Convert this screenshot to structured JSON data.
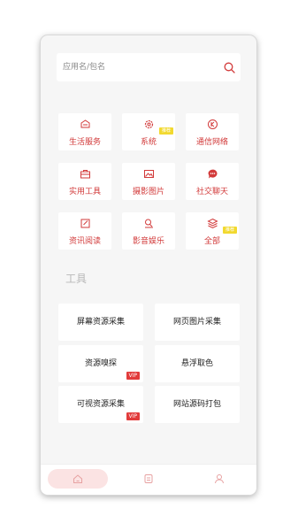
{
  "search": {
    "placeholder": "应用名/包名",
    "icon": "search-icon"
  },
  "categories": [
    {
      "label": "生活服务",
      "icon": "life-service-icon"
    },
    {
      "label": "系统",
      "icon": "system-gear-icon",
      "tag": "推荐"
    },
    {
      "label": "通信网络",
      "icon": "network-icon"
    },
    {
      "label": "实用工具",
      "icon": "toolbox-icon"
    },
    {
      "label": "摄影图片",
      "icon": "image-icon"
    },
    {
      "label": "社交聊天",
      "icon": "chat-icon"
    },
    {
      "label": "资讯阅读",
      "icon": "news-icon"
    },
    {
      "label": "影音娱乐",
      "icon": "media-icon"
    },
    {
      "label": "全部",
      "icon": "layers-icon",
      "tag": "推荐"
    }
  ],
  "tools_section": {
    "title": "工具"
  },
  "tools": [
    {
      "label": "屏幕资源采集"
    },
    {
      "label": "网页图片采集"
    },
    {
      "label": "资源嗅探",
      "badge": "VIP"
    },
    {
      "label": "悬浮取色"
    },
    {
      "label": "可视资源采集",
      "badge": "VIP"
    },
    {
      "label": "网站源码打包"
    }
  ],
  "tabbar": {
    "tabs": [
      {
        "name": "home",
        "icon": "home-icon",
        "active": true
      },
      {
        "name": "apps",
        "icon": "app-list-icon",
        "active": false
      },
      {
        "name": "profile",
        "icon": "user-icon",
        "active": false
      }
    ]
  },
  "colors": {
    "accent": "#d23a3a",
    "tag": "#f2d92f",
    "vip": "#e23b3b",
    "tab_active_bg": "#fbe3e3"
  }
}
